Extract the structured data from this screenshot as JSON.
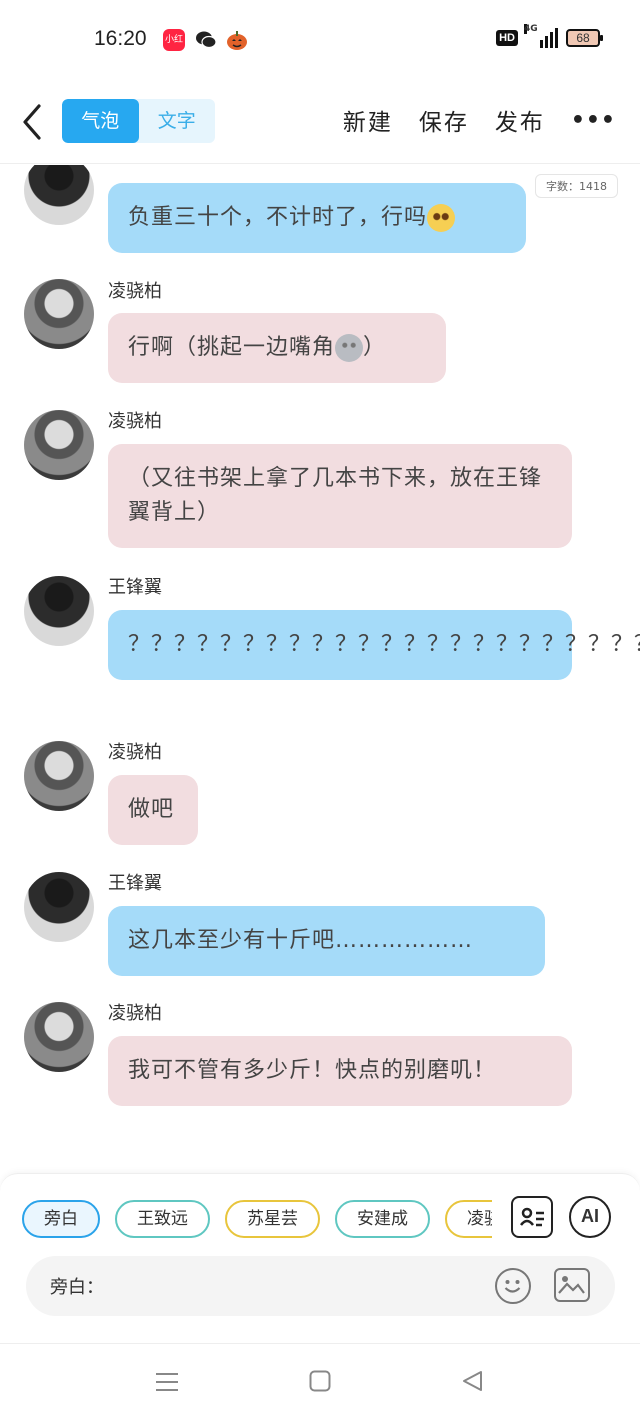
{
  "status_bar": {
    "time": "16:20",
    "hd": "HD",
    "network": "4G",
    "battery": "68",
    "icons": [
      "xiaohongshu-icon",
      "wechat-icon",
      "halloween-icon"
    ],
    "xiaohongshu_label": "小红书"
  },
  "header": {
    "tabs": [
      "气泡",
      "文字"
    ],
    "actions": [
      "新建",
      "保存",
      "发布"
    ],
    "more": "•••"
  },
  "chat": {
    "word_count": "字数：1418",
    "messages": [
      {
        "speaker": "",
        "avatar": "dark",
        "side": "blue",
        "text": "负重三十个，不计时了，行吗",
        "emoji": "pleading-face"
      },
      {
        "speaker": "凌骁柏",
        "avatar": "gray",
        "side": "pink",
        "text": "行啊（挑起一边嘴角",
        "emoji": "moon-face",
        "text_after": "）"
      },
      {
        "speaker": "凌骁柏",
        "avatar": "gray",
        "side": "pink",
        "text": "（又往书架上拿了几本书下来，放在王锋翼背上）"
      },
      {
        "speaker": "王锋翼",
        "avatar": "dark",
        "side": "blue",
        "text": "？？？？？？？？？？？？？？？？？？？？？？？"
      },
      {
        "speaker": "凌骁柏",
        "avatar": "gray",
        "side": "pink",
        "text": "做吧"
      },
      {
        "speaker": "王锋翼",
        "avatar": "dark",
        "side": "blue",
        "text": "这几本至少有十斤吧………………"
      },
      {
        "speaker": "凌骁柏",
        "avatar": "gray",
        "side": "pink",
        "text": "我可不管有多少斤！快点的别磨叽！"
      }
    ]
  },
  "panel": {
    "chips": [
      "旁白",
      "王致远",
      "苏星芸",
      "安建成",
      "凌骁柏"
    ],
    "ai_label": "AI",
    "input_label": "旁白：",
    "input_value": ""
  }
}
